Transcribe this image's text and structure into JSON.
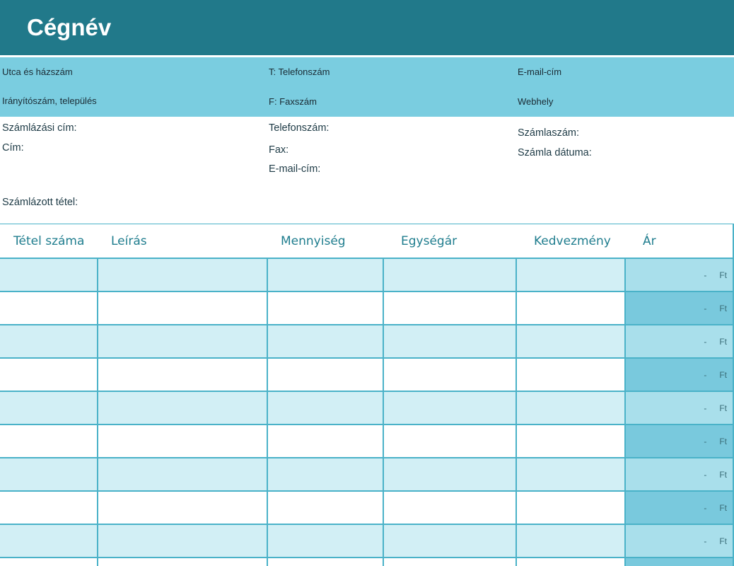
{
  "header": {
    "company_name": "Cégnév"
  },
  "contact": {
    "street": "Utca és házszám",
    "phone": "T: Telefonszám",
    "email": "E-mail-cím",
    "zip_city": "Irányítószám, település",
    "fax": "F: Faxszám",
    "website": "Webhely"
  },
  "billing": {
    "billing_address_label": "Számlázási cím:",
    "address_label": "Cím:",
    "phone_label": "Telefonszám:",
    "fax_label": "Fax:",
    "email_label": "E-mail-cím:",
    "invoice_number_label": "Számlaszám:",
    "invoice_date_label": "Számla dátuma:",
    "billed_item_label": "Számlázott tétel:"
  },
  "table": {
    "headers": {
      "item_number": "Tétel száma",
      "description": "Leírás",
      "quantity": "Mennyiség",
      "unit_price": "Egységár",
      "discount": "Kedvezmény",
      "price": "Ár"
    },
    "rows": [
      {
        "price_dash": "-",
        "currency": "Ft"
      },
      {
        "price_dash": "-",
        "currency": "Ft"
      },
      {
        "price_dash": "-",
        "currency": "Ft"
      },
      {
        "price_dash": "-",
        "currency": "Ft"
      },
      {
        "price_dash": "-",
        "currency": "Ft"
      },
      {
        "price_dash": "-",
        "currency": "Ft"
      },
      {
        "price_dash": "-",
        "currency": "Ft"
      },
      {
        "price_dash": "-",
        "currency": "Ft"
      },
      {
        "price_dash": "-",
        "currency": "Ft"
      },
      {
        "price_dash": "",
        "currency": ""
      }
    ]
  },
  "colors": {
    "header_bg": "#21798a",
    "contact_band_bg": "#7acde0",
    "row_light": "#d2eff5",
    "price_light": "#a9dfeb",
    "price_dark": "#79c9dd",
    "grid_line": "#4ab2c8",
    "header_text": "#1f7d8e"
  }
}
